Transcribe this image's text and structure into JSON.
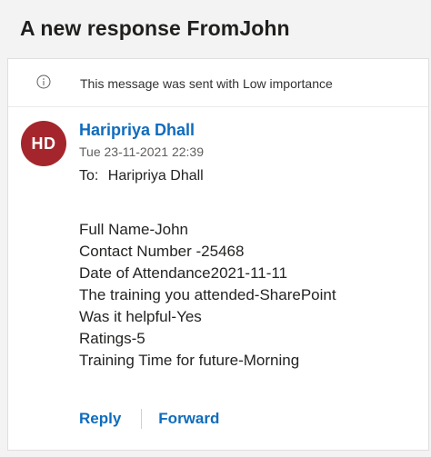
{
  "subject": "A new response FromJohn",
  "info_bar": {
    "icon": "info-icon",
    "text": "This message was sent with Low importance"
  },
  "sender": {
    "initials": "HD",
    "name": "Haripriya Dhall",
    "datetime": "Tue 23-11-2021 22:39",
    "avatar_color": "#a4262c"
  },
  "to": {
    "label": "To:",
    "recipient": "Haripriya Dhall"
  },
  "body": {
    "lines": [
      "Full Name-John",
      "Contact Number -25468",
      "Date of Attendance2021-11-11",
      "The training you attended-SharePoint",
      "Was it helpful-Yes",
      "Ratings-5",
      "Training Time for future-Morning"
    ]
  },
  "actions": {
    "reply_label": "Reply",
    "forward_label": "Forward"
  },
  "colors": {
    "accent": "#0f6cbd",
    "background": "#f3f3f3"
  }
}
